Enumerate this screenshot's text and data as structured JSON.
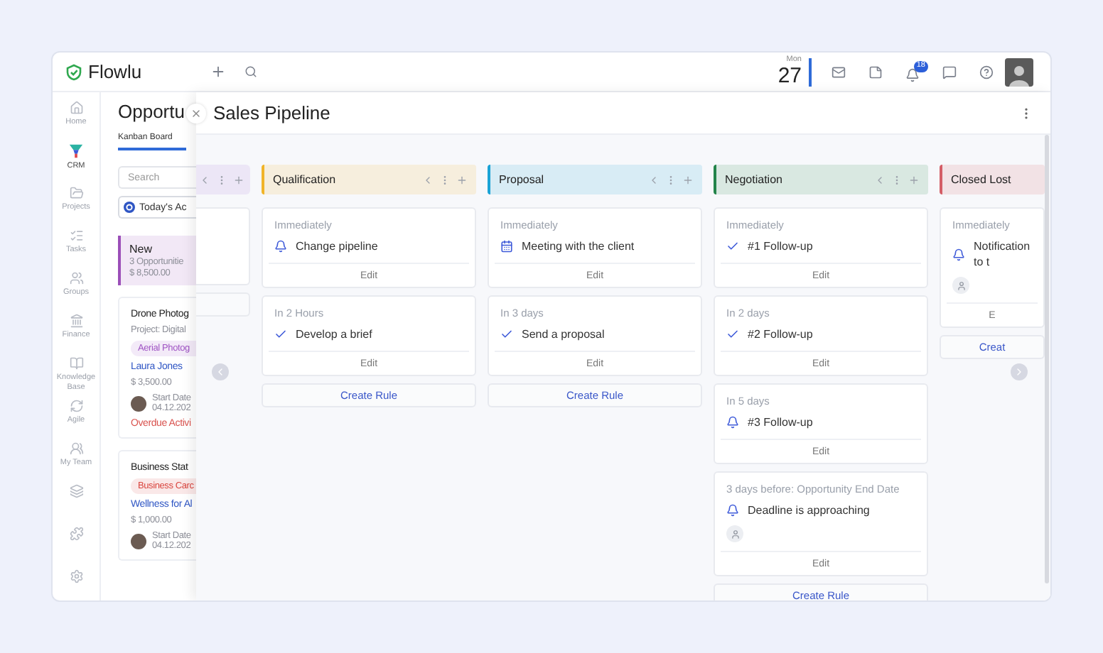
{
  "topbar": {
    "brand": "Flowlu",
    "date": {
      "weekday": "Mon",
      "day": "27"
    },
    "notifications_badge": "18"
  },
  "nav": {
    "items": [
      {
        "label": "Home",
        "selected": false
      },
      {
        "label": "CRM",
        "selected": true
      },
      {
        "label": "Projects",
        "selected": false
      },
      {
        "label": "Tasks",
        "selected": false
      },
      {
        "label": "Groups",
        "selected": false
      },
      {
        "label": "Finance",
        "selected": false
      },
      {
        "label": "Knowledge Base",
        "selected": false
      },
      {
        "label": "Agile",
        "selected": false
      },
      {
        "label": "My Team",
        "selected": false
      }
    ]
  },
  "opportunities": {
    "title": "Opportu",
    "tabs": [
      {
        "label": "Kanban Board",
        "selected": true
      }
    ],
    "search": {
      "placeholder": "Search"
    },
    "filter": {
      "label": "Today's Ac"
    },
    "stage": {
      "name": "New",
      "count": "3 Opportunitie",
      "amount": "$ 8,500.00",
      "color": "#9b4fb8"
    },
    "deals": [
      {
        "title": "Drone Photog",
        "project": "Project: Digital",
        "tag": {
          "label": "Aerial Photog",
          "color": "#a055c4"
        },
        "contact": "Laura Jones",
        "amount": "$ 3,500.00",
        "start_label": "Start Date",
        "start_date": "04.12.202",
        "overdue": "Overdue Activi"
      },
      {
        "title": "Business Stat",
        "tag": {
          "label": "Business Carc",
          "color": "#d9453f"
        },
        "contact": "Wellness for Al",
        "amount": "$ 1,000.00",
        "start_label": "Start Date",
        "start_date": "04.12.202"
      }
    ]
  },
  "pipeline": {
    "title": "Sales Pipeline",
    "columns": [
      {
        "kind": "stub",
        "color": "#ece6f6"
      },
      {
        "kind": "stage",
        "name": "Qualification",
        "color": "#f0b429",
        "create_label": "Create Rule",
        "rules": [
          {
            "when": "Immediately",
            "kind": "notification",
            "action": "Change pipeline",
            "has_assignee": false,
            "edit": "Edit"
          },
          {
            "when": "In 2 Hours",
            "kind": "task",
            "action": "Develop a brief",
            "has_assignee": false,
            "edit": "Edit"
          }
        ]
      },
      {
        "kind": "stage",
        "name": "Proposal",
        "color": "#1aa3d6",
        "create_label": "Create Rule",
        "rules": [
          {
            "when": "Immediately",
            "kind": "event",
            "action": "Meeting with the client",
            "has_assignee": false,
            "edit": "Edit"
          },
          {
            "when": "In 3 days",
            "kind": "task",
            "action": "Send a proposal",
            "has_assignee": false,
            "edit": "Edit"
          }
        ]
      },
      {
        "kind": "stage",
        "name": "Negotiation",
        "color": "#23844a",
        "create_label": "Create Rule",
        "rules": [
          {
            "when": "Immediately",
            "kind": "task",
            "action": "#1 Follow-up",
            "has_assignee": false,
            "edit": "Edit"
          },
          {
            "when": "In 2 days",
            "kind": "task",
            "action": "#2 Follow-up",
            "has_assignee": false,
            "edit": "Edit"
          },
          {
            "when": "In 5 days",
            "kind": "notification",
            "action": "#3 Follow-up",
            "has_assignee": false,
            "edit": "Edit"
          },
          {
            "when": "3 days before: Opportunity End Date",
            "kind": "notification",
            "action": "Deadline is approaching",
            "has_assignee": true,
            "edit": "Edit"
          }
        ]
      },
      {
        "kind": "stage",
        "name": "Closed Lost",
        "color": "#d45d66",
        "create_label": "Creat",
        "rules": [
          {
            "when": "Immediately",
            "kind": "notification",
            "action": "Notification to t",
            "has_assignee": true,
            "edit": "E"
          }
        ]
      }
    ]
  }
}
